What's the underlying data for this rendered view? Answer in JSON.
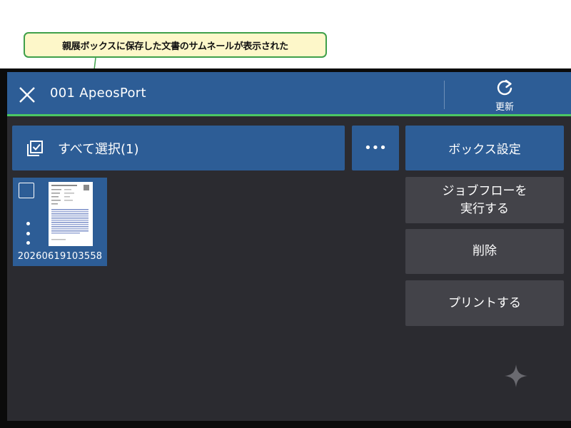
{
  "callout": {
    "text": "親展ボックスに保存した文書のサムネールが表示された"
  },
  "header": {
    "title": "001 ApeosPort",
    "refresh_label": "更新"
  },
  "toolbar": {
    "select_all_label": "すべて選択(1)",
    "more_label": "•••"
  },
  "side_buttons": {
    "box_settings": "ボックス設定",
    "job_flow": "ジョブフローを\n実行する",
    "delete": "削除",
    "print": "プリントする"
  },
  "documents": [
    {
      "name": "20260619103558",
      "checked": false
    }
  ],
  "colors": {
    "header_blue": "#2d5d96",
    "accent_green": "#4bc763",
    "panel_dark": "#2b2b30",
    "button_gray": "#434349",
    "callout_bg": "#fdf7c9",
    "callout_border": "#3fa04a"
  }
}
